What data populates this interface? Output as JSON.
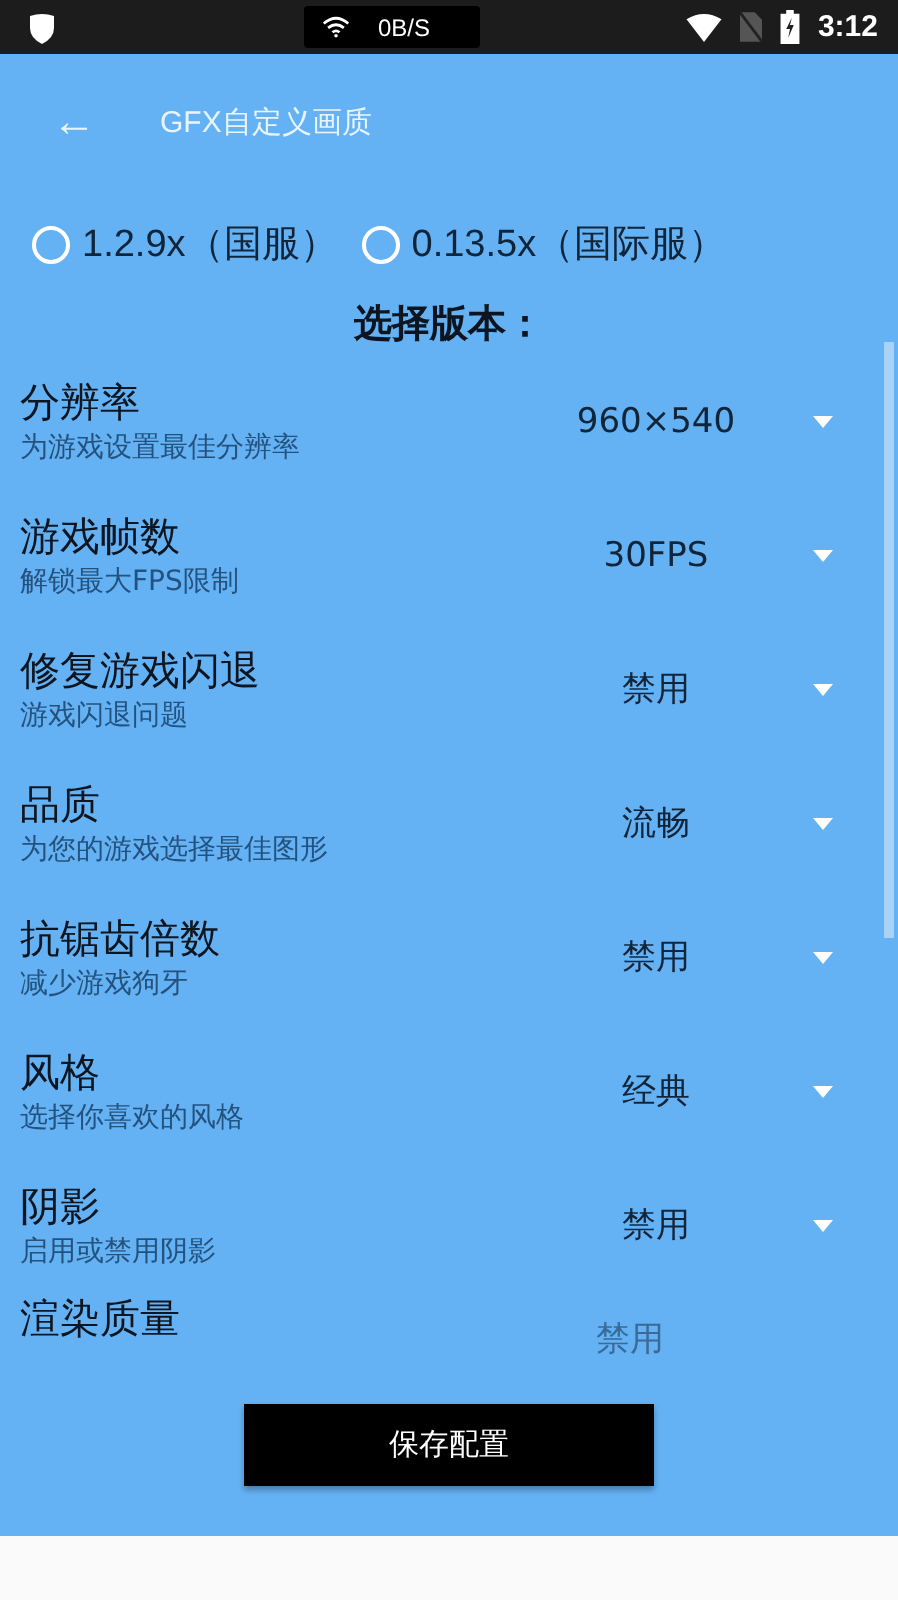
{
  "status_bar": {
    "speed": "0B/S",
    "time": "3:12"
  },
  "toolbar": {
    "back": "←",
    "title": "GFX自定义画质"
  },
  "versions": [
    {
      "label": "1.2.9x（国服）",
      "selected": false
    },
    {
      "label": "0.13.5x（国际服）",
      "selected": false
    }
  ],
  "section_title": "选择版本：",
  "settings": [
    {
      "label": "分辨率",
      "hint": "为游戏设置最佳分辨率",
      "value": "960×540"
    },
    {
      "label": "游戏帧数",
      "hint": "解锁最大FPS限制",
      "value": "30FPS"
    },
    {
      "label": "修复游戏闪退",
      "hint": "游戏闪退问题",
      "value": "禁用"
    },
    {
      "label": "品质",
      "hint": "为您的游戏选择最佳图形",
      "value": "流畅"
    },
    {
      "label": "抗锯齿倍数",
      "hint": "减少游戏狗牙",
      "value": "禁用"
    },
    {
      "label": "风格",
      "hint": "选择你喜欢的风格",
      "value": "经典"
    },
    {
      "label": "阴影",
      "hint": "启用或禁用阴影",
      "value": "禁用"
    },
    {
      "label": "渲染质量",
      "value": "禁用"
    }
  ],
  "save_button": "保存配置"
}
